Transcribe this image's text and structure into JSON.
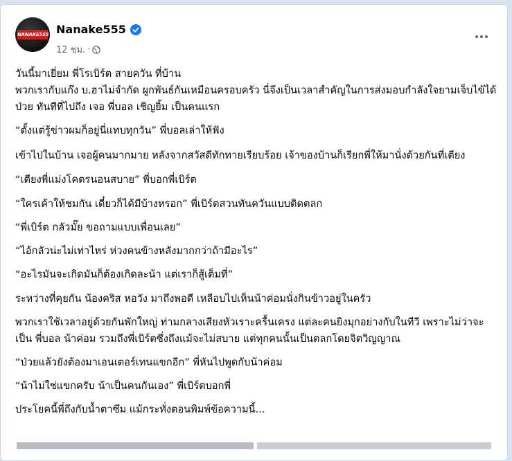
{
  "post": {
    "author": "Nanake555",
    "avatar_text": "NANAKE555",
    "timestamp": "12 ชม.",
    "separator": "·",
    "paragraphs": [
      "วันนี้มาเยี่ยม พี่โรเบิร์ต สายควัน ที่บ้าน\nพวกเรากับแก๊ง บ.ฮาไม่จำกัด ผูกพันธ์กันเหมือนครอบครัว นี่จึงเป็นเวลาสำคัญในการส่งมอบกำลังใจยามเจ็บไข้ได้ป่วย  ทันทีที่ไปถึง เจอ พี่บอล เชิญยิ้ม เป็นคนแรก",
      "“ตั้งแต่รู้ข่าวผมก็อยู่นี่แทบทุกวัน” พี่บอลเล่าให้ฟัง",
      "เข้าไปในบ้าน เจอผู้คนมากมาย หลังจากสวัสดีทักทายเรียบร้อย เจ้าของบ้านก็เรียกพี่ให้มานั่งด้วยกันที่เตียง",
      "“เตียงพี่แม่งโคตรนอนสบาย” พี่บอกพี่เบิร์ต",
      "“ใครเค้าให้ชมกัน เดี๋ยวก็ได้มีบ้างหรอก” พี่เบิร์ตสวนทันควันแบบติดตลก",
      "“พี่เบิร์ต กลัวมั๊ย ขอถามแบบเพื่อนเลย”",
      "“ไอ้กลัวน่ะไม่เท่าไหร่ ห่วงคนข้างหลังมากกว่าถ้ามีอะไร”",
      "“อะไรมันจะเกิดมันก็ต้องเกิดละน้า แต่เราก็สู้เต็มที่”",
      "ระหว่างที่คุยกัน น้องคริส หอวัง มาถึงพอดี เหลือบไปเห็นน้าค่อมนั่งกินข้าวอยู่ในครัว",
      "พวกเราใช้เวลาอยู่ด้วยกันพักใหญ่ ท่ามกลางเสียงหัวเราะครื้นเครง แต่ละคนยิงมุกอย่างกับในทีวี เพราะไม่ว่าจะเป็น พี่บอล น้าค่อม รวมถึงพี่เบิร์ตซึ่งถึงแม้จะไม่สบาย แต่ทุกคนนั้นเป็นตลกโดยจิตวิญญาณ",
      "“ป่วยแล้วยังต้องมาเอนเตอร์เทนแขกอีก” พี่หันไปพูดกับน้าค่อม",
      "“น้าไม่ใช่แขกครับ น้าเป็นคนกันเอง” พี่เบิร์ตบอกพี่",
      "ประโยคนี้พี่ถึงกับน้ำตาซึม แม้กระทั่งตอนพิมพ์ข้อความนี้..."
    ]
  },
  "colors": {
    "verified": "#1877f2",
    "meta": "#65676b",
    "text": "#050505",
    "logo_red": "#c8201e"
  },
  "icons": {
    "verified": "verified-badge-icon",
    "privacy": "globe-icon",
    "menu": "more-options-icon"
  }
}
